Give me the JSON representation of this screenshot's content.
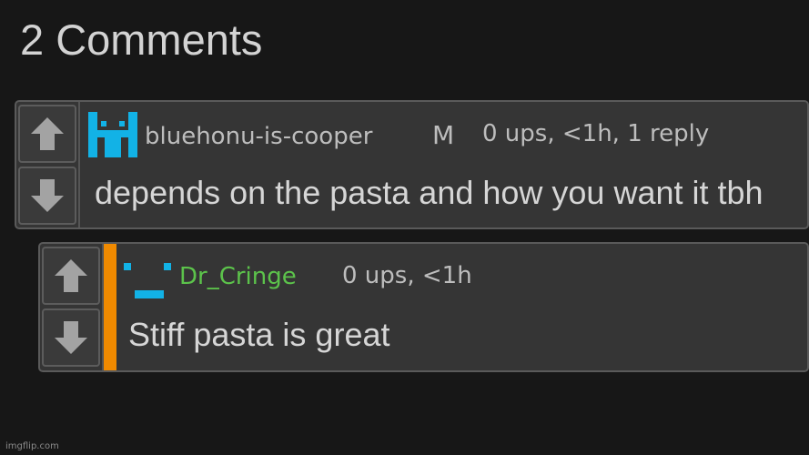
{
  "heading": "2 Comments",
  "comments": [
    {
      "username": "bluehonu-is-cooper",
      "badge": "M",
      "meta": "0 ups, <1h, 1 reply",
      "text": "depends on the pasta and how you want it tbh",
      "username_color": "#bdbdbd",
      "avatar_icon": "pixel-crown-avatar-icon",
      "avatar_color": "#12b2e6"
    },
    {
      "username": "Dr_Cringe",
      "meta": "0 ups, <1h",
      "text": "Stiff pasta is great",
      "username_color": "#5cc34b",
      "avatar_icon": "pixel-face-avatar-icon",
      "avatar_color": "#12b2e6",
      "reply_bar_color": "#f08a00"
    }
  ],
  "watermark": "imgflip.com"
}
